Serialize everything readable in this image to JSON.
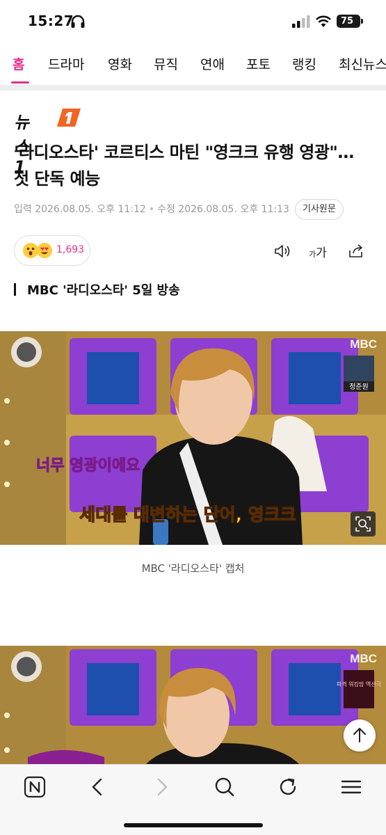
{
  "status_bar": {
    "time": "15:27",
    "battery": "75"
  },
  "nav": {
    "tabs": [
      {
        "label": "홈",
        "active": true
      },
      {
        "label": "드라마"
      },
      {
        "label": "영화"
      },
      {
        "label": "뮤직"
      },
      {
        "label": "연애"
      },
      {
        "label": "포토"
      },
      {
        "label": "랭킹"
      },
      {
        "label": "최신뉴스"
      }
    ]
  },
  "article": {
    "publisher": "뉴스1",
    "title": "'라디오스타' 코르티스 마틴 \"영크크 유행 영광\"…첫 단독 예능",
    "published": "입력 2026.08.05. 오후 11:12",
    "updated": "수정 2026.08.05. 오후 11:13",
    "source_button": "기사원문",
    "reaction_count": "1,693",
    "font_size_label": "가",
    "font_size_small": "가",
    "subheading": "MBC '라디오스타' 5일 방송",
    "image_caption": "MBC '라디오스타' 캡처"
  },
  "photo_1": {
    "broadcaster": "MBC",
    "subtitle_top": "너무 영광이에요",
    "subtitle_bottom": "세대를 대변하는 단어, 영크크",
    "pip_name": "정준원"
  },
  "photo_2": {
    "broadcaster": "MBC",
    "pip_text": "파격 워킹맘 액션극"
  },
  "colors": {
    "accent": "#e62e8b",
    "logo_orange": "#f26522"
  }
}
